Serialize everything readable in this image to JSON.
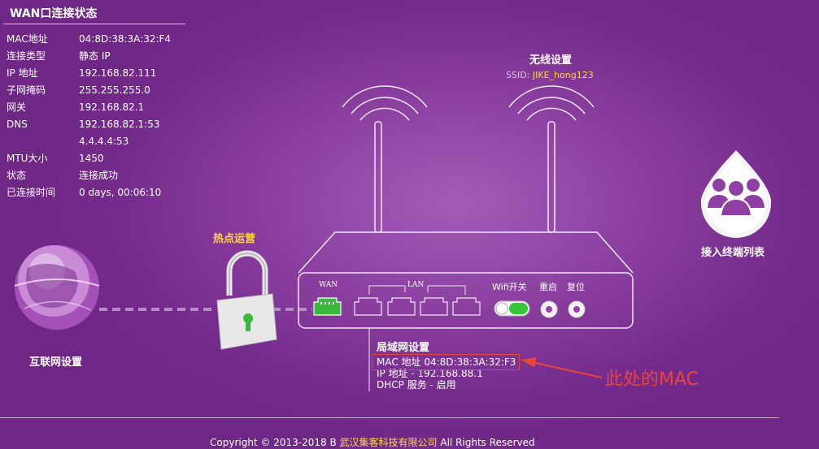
{
  "wan": {
    "title": "WAN口连接状态",
    "rows": [
      {
        "label": "MAC地址",
        "value": "04:8D:38:3A:32:F4"
      },
      {
        "label": "连接类型",
        "value": "静态 IP"
      },
      {
        "label": "IP 地址",
        "value": "192.168.82.111"
      },
      {
        "label": "子网掩码",
        "value": "255.255.255.0"
      },
      {
        "label": "网关",
        "value": "192.168.82.1"
      },
      {
        "label": "DNS",
        "value": "192.168.82.1:53"
      },
      {
        "label": "",
        "value": "4.4.4.4:53"
      },
      {
        "label": "MTU大小",
        "value": "1450"
      },
      {
        "label": "状态",
        "value": "连接成功"
      },
      {
        "label": "已连接时间",
        "value": "0 days, 00:06:10"
      }
    ]
  },
  "wireless": {
    "title": "无线设置",
    "ssid_label": "SSID:",
    "ssid_value": "JIKE_hong123"
  },
  "clients": {
    "label": "接入终端列表"
  },
  "hotspot": {
    "label": "热点运营"
  },
  "internet": {
    "label": "互联网设置"
  },
  "router": {
    "wan_port": "WAN",
    "lan_ports": "LAN",
    "wifi_switch": "Wifi开关",
    "restart": "重启",
    "reset": "复位"
  },
  "lan": {
    "title": "局域网设置",
    "mac": "MAC 地址 04:8D:38:3A:32:F3",
    "ip": "IP 地址 - 192.168.88.1",
    "dhcp": "DHCP 服务 - 启用"
  },
  "annotation": {
    "text": "此处的MAC"
  },
  "footer": {
    "prefix": "Copyright © 2013-2018 B",
    "company": "武汉集客科技有限公司",
    "suffix": "All Rights Reserved"
  },
  "colors": {
    "background": "#8a3f9f",
    "accent_yellow": "#ffd84a",
    "annotation_red": "#e8453b",
    "port_active_green": "#3cb93c"
  }
}
